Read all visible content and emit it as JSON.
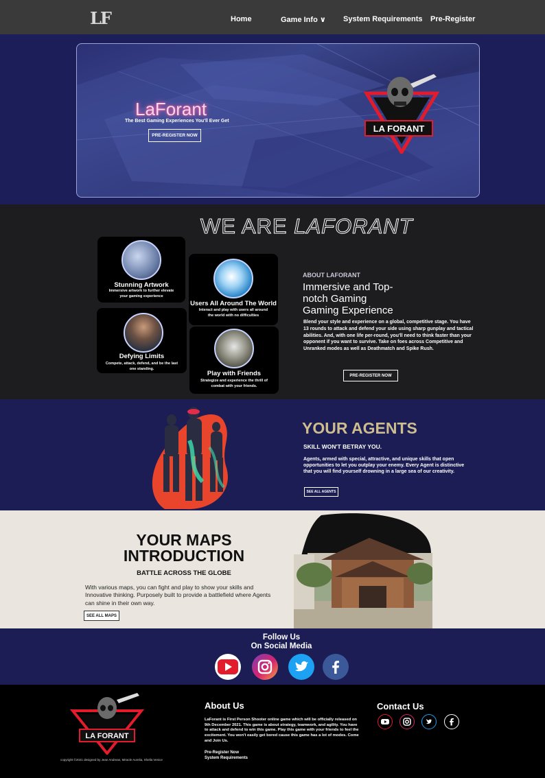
{
  "nav": {
    "logo": "LF",
    "items": [
      "Home",
      "Game Info ∨",
      "System Requirements",
      "Pre-Register"
    ]
  },
  "hero": {
    "title": "LaForant",
    "subtitle": "The Best Gaming Experiences You'll Ever Get",
    "button": "PRE-REGISTER NOW",
    "badge_text": "LA FORANT"
  },
  "we_are": {
    "title_plain": "WE ARE",
    "title_italic": "LAFORANT",
    "features": [
      {
        "title": "Stunning Artwork",
        "text": "Immersive artwork to further elevate your gaming experience"
      },
      {
        "title": "Users All Around The World",
        "text": "Interact and play with users all around the world with no difficulties"
      },
      {
        "title": "Defying Limits",
        "text": "Compete, attack, defend, and be the last one standing."
      },
      {
        "title": "Play with Friends",
        "text": "Strategize and experience the thrill of combat with your friends."
      }
    ],
    "about_kicker": "ABOUT LAFORANT",
    "about_heading": "Immersive and Top-notch Gaming Gaming Experience",
    "about_body": "Blend your style and experience on a global, competitive stage. You have 13 rounds to attack and defend your side using sharp gunplay and tactical abilities. And, with one life per-round, you'll need to think faster than your opponent if you want to survive. Take on foes across Competitive and Unranked modes as well as Deathmatch and Spike Rush.",
    "about_button": "PRE-REGISTER NOW"
  },
  "agents": {
    "title": "YOUR AGENTS",
    "subtitle": "SKILL WON'T BETRAY YOU.",
    "body": "Agents, armed with special, attractive, and unique skills that open opportunities to let you outplay your enemy. Every Agent is distinctive that you will find yourself drowning in a large sea of our creativity.",
    "button": "SEE ALL AGENTS"
  },
  "maps": {
    "title_line1": "YOUR MAPS",
    "title_line2": "INTRODUCTION",
    "subtitle": "BATTLE ACROSS THE GLOBE",
    "body": "With various maps, you can fight and play to show your skills and Innovative thinking. Purposely built to provide a battlefield where Agents can shine in their own way.",
    "button": "SEE ALL MAPS"
  },
  "social": {
    "heading_line1": "Follow Us",
    "heading_line2": "On Social Media",
    "icons": [
      "youtube-icon",
      "instagram-icon",
      "twitter-icon",
      "facebook-icon"
    ]
  },
  "footer": {
    "badge_text": "LA FORANT",
    "copyright": "copyright ©2021 designed by Jean Andreas, Miracle Aurelia, Shella Venice",
    "about_heading": "About Us",
    "about_text": "LaForant is First Person Shooter online game which will be officially released on 9th December 2021. This game is about strategy, teamwork, and agility. You have to attack and defend to win this game. Play this game with your friends to feel the excitement. You won't easily get bored cause this game has a lot of modes. Come and Join Us.",
    "links": [
      "Pre-Register Now",
      "System Requirements"
    ],
    "contact_heading": "Contact Us"
  },
  "colors": {
    "nav_bg": "#3a3a3a",
    "navy": "#1c1d55",
    "dark": "#1d1d1f",
    "gold": "#cdbd8f",
    "cream": "#eae6df",
    "brand_red": "#e21b2d"
  }
}
